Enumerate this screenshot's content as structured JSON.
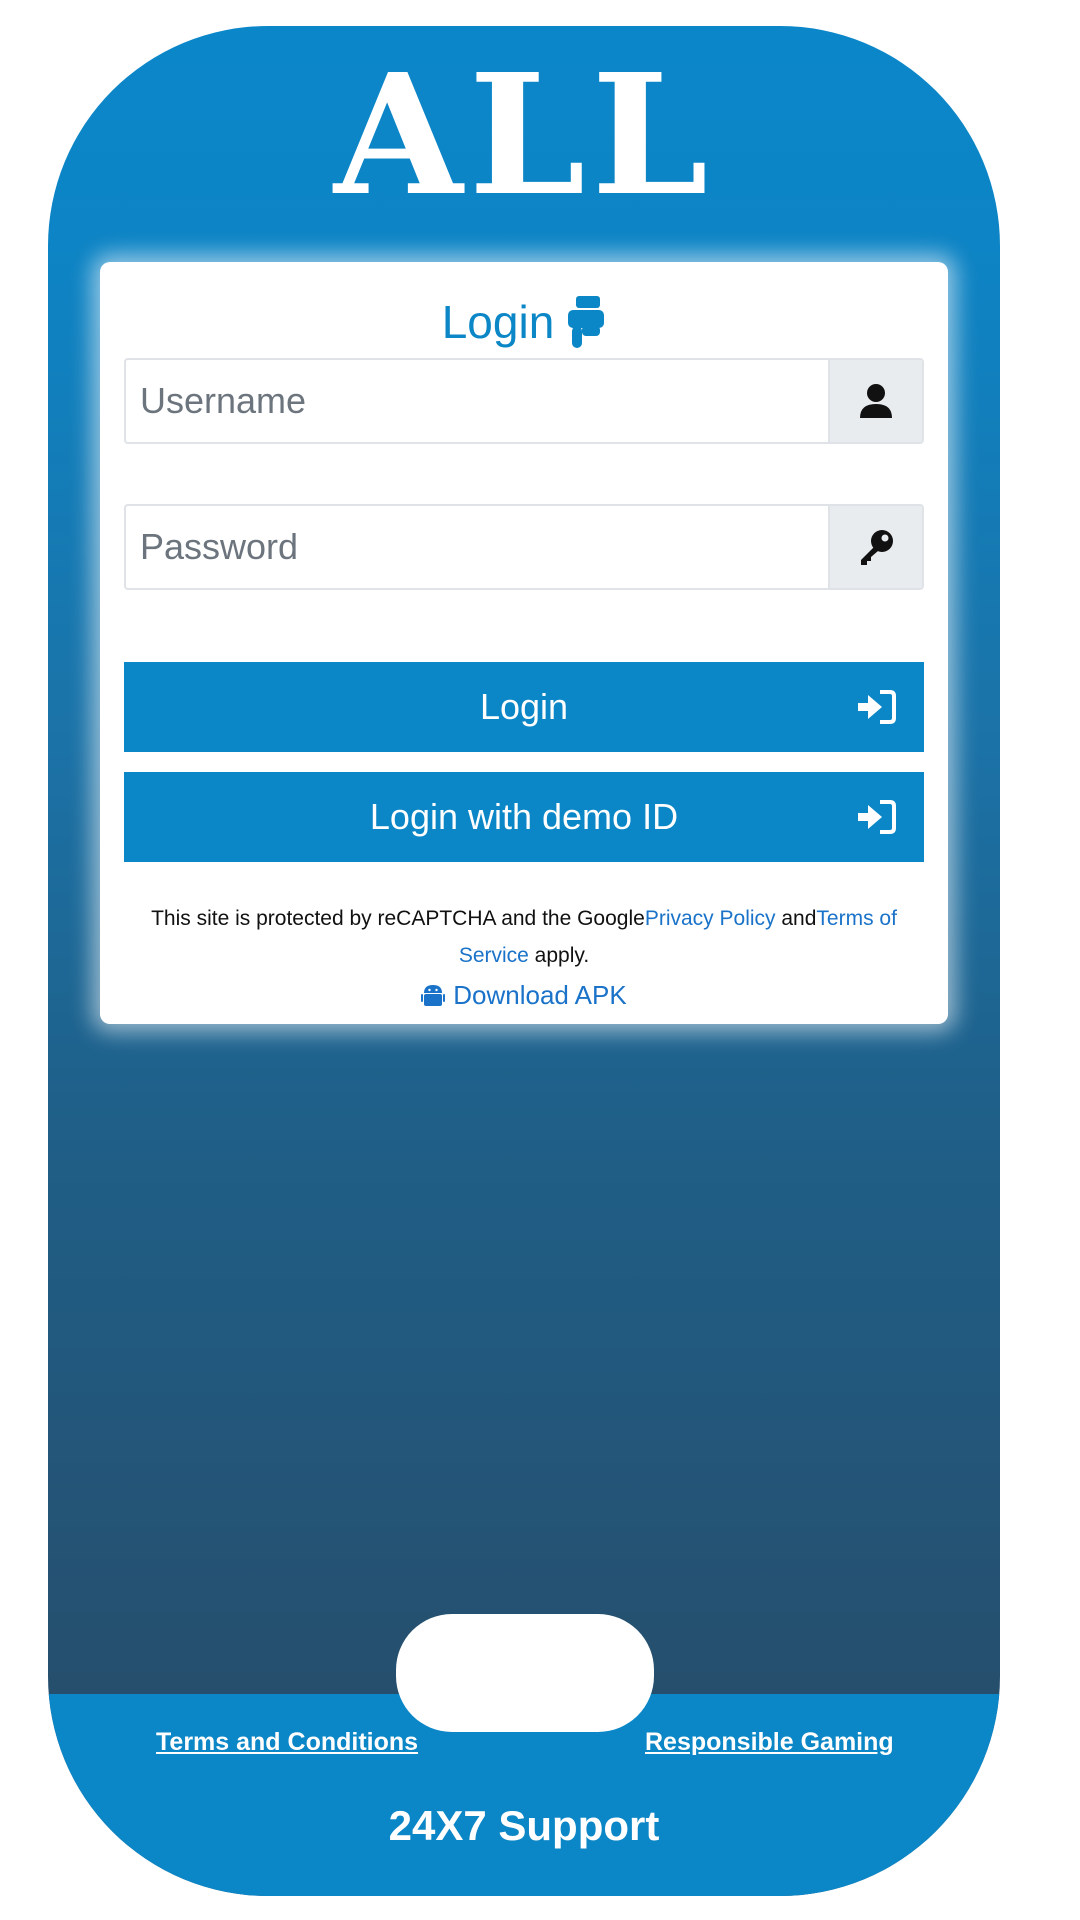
{
  "brand": {
    "logo_text": "ALL"
  },
  "login_card": {
    "title": "Login",
    "username": {
      "placeholder": "Username",
      "value": ""
    },
    "password": {
      "placeholder": "Password",
      "value": ""
    },
    "login_button": "Login",
    "demo_button": "Login with demo ID",
    "recaptcha": {
      "prefix": "This site is protected by reCAPTCHA and the Google",
      "privacy_link": "Privacy Policy",
      "middle": " and",
      "terms_link": "Terms of Service",
      "suffix": " apply."
    },
    "download_apk": "Download APK"
  },
  "footer": {
    "terms_link": "Terms and Conditions",
    "responsible_link": "Responsible Gaming",
    "support_text": "24X7 Support"
  },
  "icons": {
    "title": "hand-pointing-down-icon",
    "username": "user-icon",
    "password": "key-icon",
    "login": "sign-in-icon",
    "apk": "android-icon"
  },
  "colors": {
    "accent": "#0b86c6",
    "link": "#1a73c9",
    "addon_bg": "#e9ecef"
  }
}
